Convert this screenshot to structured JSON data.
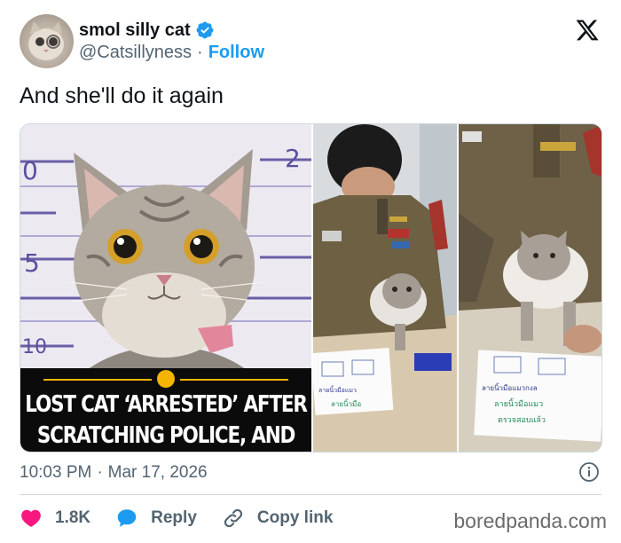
{
  "author": {
    "display_name": "smol silly cat",
    "handle": "@Catsillyness",
    "separator": "·",
    "follow_label": "Follow",
    "verified_color": "#1d9bf0"
  },
  "tweet": {
    "text": "And she'll do it again"
  },
  "media": {
    "headline": "LOST CAT ‘ARRESTED’ AFTER\nSCRATCHING POLICE, AND HER\nMUGSHOT WENT VIRAL",
    "panels": [
      "cat-mugshot-photo",
      "officer-fingerprinting-cat-photo",
      "cat-paw-print-photo"
    ]
  },
  "meta": {
    "time": "10:03 PM",
    "separator": "·",
    "date": "Mar 17, 2026"
  },
  "actions": {
    "like_count": "1.8K",
    "reply_label": "Reply",
    "copy_link_label": "Copy link",
    "like_color": "#f91880",
    "reply_color": "#1d9bf0"
  },
  "watermark": "boredpanda.com",
  "icons": [
    "verified-badge-icon",
    "x-logo-icon",
    "info-icon",
    "heart-icon",
    "reply-bubble-icon",
    "link-icon"
  ]
}
